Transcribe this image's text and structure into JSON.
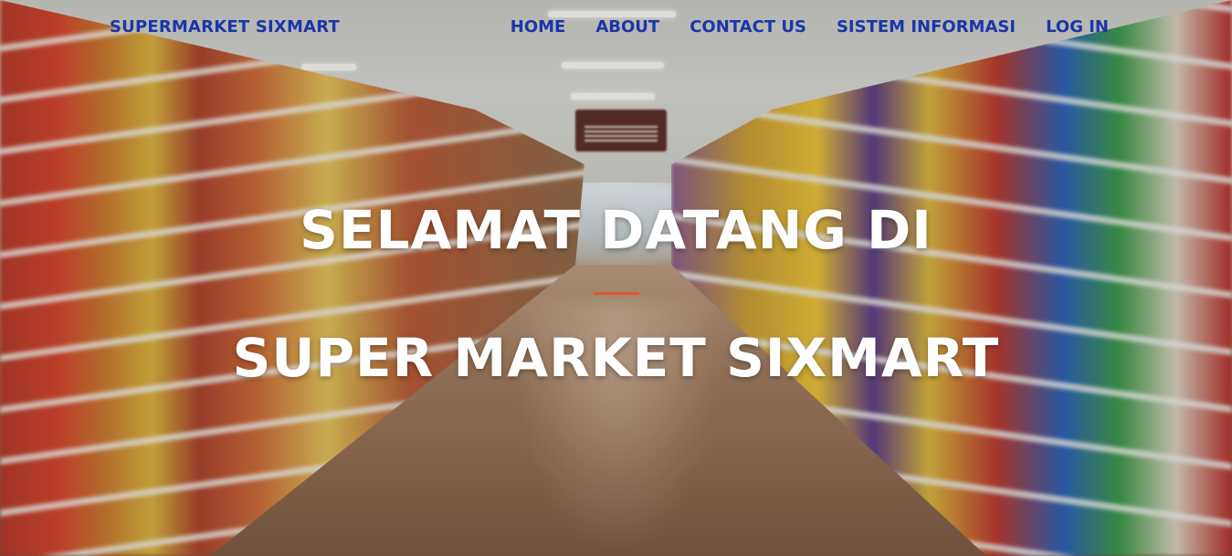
{
  "brand": "SUPERMARKET SIXMART",
  "nav": {
    "home": "HOME",
    "about": "ABOUT",
    "contact": "CONTACT US",
    "sistem": "SISTEM INFORMASI",
    "login": "LOG IN"
  },
  "hero": {
    "line1": "SELAMAT DATANG DI",
    "line2": "SUPER MARKET SIXMART",
    "background": "supermarket-aisle-photo"
  },
  "colors": {
    "nav_text": "#1a36a8",
    "hero_text": "#ffffff",
    "divider": "#e0542e"
  }
}
